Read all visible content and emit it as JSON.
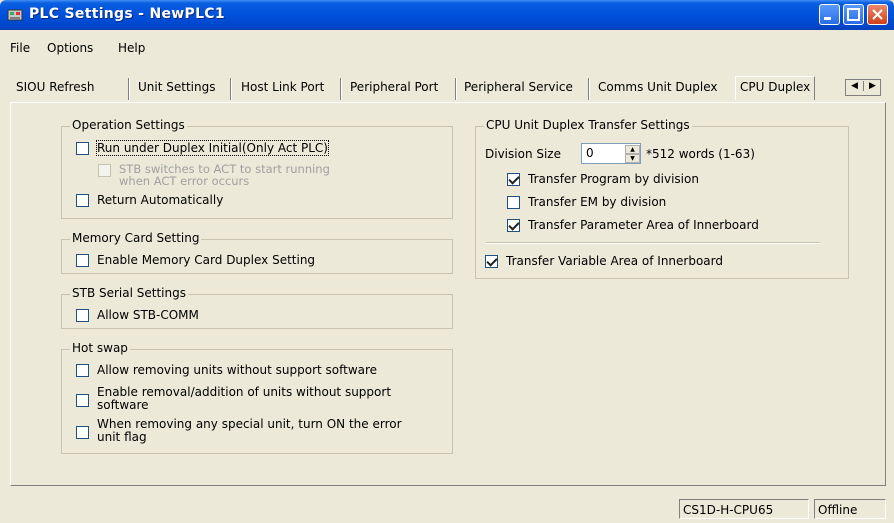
{
  "window": {
    "title": "PLC Settings - NewPLC1",
    "title_colors": {
      "bar": "#0050dc",
      "text": "#ffffff"
    }
  },
  "menu": [
    "File",
    "Options",
    "Help"
  ],
  "tabs": {
    "items": [
      "SIOU Refresh",
      "Unit Settings",
      "Host Link Port",
      "Peripheral Port",
      "Peripheral Service",
      "Comms Unit Duplex",
      "CPU Duplex"
    ],
    "active": "CPU Duplex"
  },
  "operation_settings": {
    "title": "Operation Settings",
    "run_under_duplex": {
      "label": "Run under Duplex Initial(Only Act PLC)",
      "checked": false
    },
    "stb_switches": {
      "label_line1": "STB switches to ACT to start running",
      "label_line2": "when ACT error occurs",
      "checked": false,
      "enabled": false
    },
    "return_automatically": {
      "label": "Return Automatically",
      "checked": false
    }
  },
  "memory_card": {
    "title": "Memory Card Setting",
    "enable_duplex": {
      "label": "Enable Memory Card Duplex Setting",
      "checked": false
    }
  },
  "stb_serial": {
    "title": "STB Serial Settings",
    "allow_stb_comm": {
      "label": "Allow STB-COMM",
      "checked": false
    }
  },
  "hot_swap": {
    "title": "Hot swap",
    "allow_removing": {
      "label": "Allow removing units without support software",
      "checked": false
    },
    "enable_removal_line1": "Enable removal/addition of units without support",
    "enable_removal_line2": "software",
    "enable_removal_checked": false,
    "error_flag_line1": "When removing any special unit, turn ON the error",
    "error_flag_line2": "unit flag",
    "error_flag_checked": false
  },
  "cpu_transfer": {
    "title": "CPU Unit Duplex Transfer Settings",
    "division_size_label": "Division Size",
    "division_size_value": "0",
    "division_size_unit": "*512 words (1-63)",
    "transfer_program": {
      "label": "Transfer Program by division",
      "checked": true
    },
    "transfer_em": {
      "label": "Transfer EM by division",
      "checked": false
    },
    "transfer_parameter": {
      "label": "Transfer Parameter Area of Innerboard",
      "checked": true
    },
    "transfer_variable": {
      "label": "Transfer Variable Area of Innerboard",
      "checked": true
    }
  },
  "status": {
    "cpu_model": "CS1D-H-CPU65",
    "connection": "Offline"
  }
}
